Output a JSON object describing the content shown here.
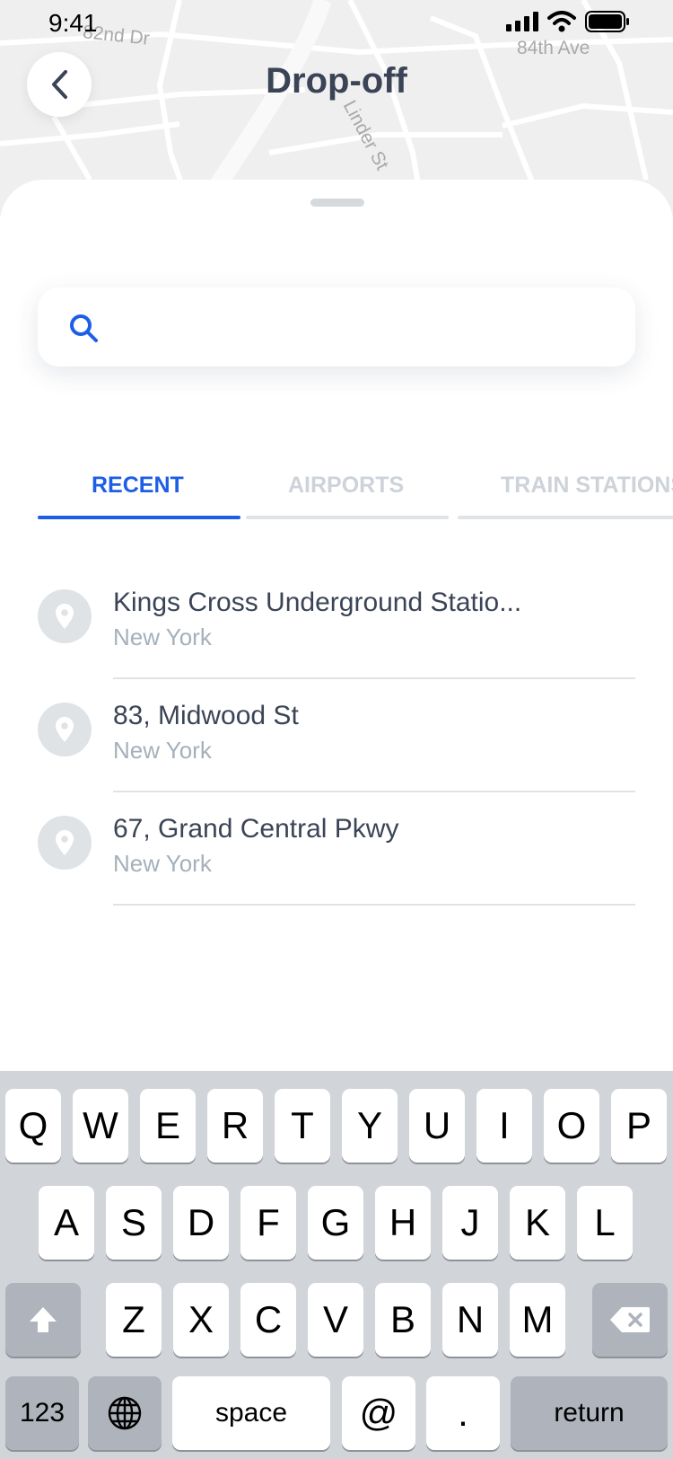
{
  "status_bar": {
    "time": "9:41"
  },
  "map": {
    "labels": [
      "82nd Dr",
      "84th Ave",
      "Linder St"
    ]
  },
  "header": {
    "title": "Drop-off"
  },
  "search": {
    "value": "",
    "placeholder": ""
  },
  "tabs": [
    {
      "label": "RECENT",
      "active": true
    },
    {
      "label": "AIRPORTS",
      "active": false
    },
    {
      "label": "TRAIN STATIONS",
      "active": false
    }
  ],
  "places": [
    {
      "title": "Kings Cross Underground Statio...",
      "subtitle": "New York"
    },
    {
      "title": "83, Midwood St",
      "subtitle": "New York"
    },
    {
      "title": "67, Grand Central Pkwy",
      "subtitle": "New York"
    }
  ],
  "keyboard": {
    "row1": [
      "Q",
      "W",
      "E",
      "R",
      "T",
      "Y",
      "U",
      "I",
      "O",
      "P"
    ],
    "row2": [
      "A",
      "S",
      "D",
      "F",
      "G",
      "H",
      "J",
      "K",
      "L"
    ],
    "row3": [
      "Z",
      "X",
      "C",
      "V",
      "B",
      "N",
      "M"
    ],
    "numbers_key": "123",
    "space_key": "space",
    "at_key": "@",
    "dot_key": ".",
    "return_key": "return"
  },
  "colors": {
    "accent": "#1c5ee6",
    "text": "#3b4456",
    "muted": "#a4b0bb",
    "inactive_tab": "#cdd3d9"
  }
}
